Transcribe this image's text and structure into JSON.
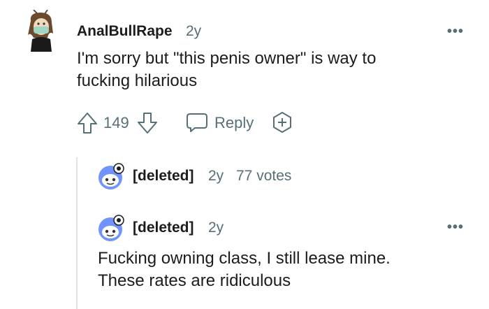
{
  "comment": {
    "username": "AnalBullRape",
    "age": "2y",
    "body_line1": "I'm sorry but \"this penis owner\" is way to",
    "body_line2": "fucking hilarious",
    "vote_count": "149",
    "reply_label": "Reply",
    "more_label": "•••"
  },
  "collapsed_reply": {
    "username": "[deleted]",
    "age": "2y",
    "votes": "77 votes"
  },
  "reply": {
    "username": "[deleted]",
    "age": "2y",
    "body_line1": "Fucking owning class, I still lease mine.",
    "body_line2": "These rates are ridiculous",
    "more_label": "•••"
  }
}
